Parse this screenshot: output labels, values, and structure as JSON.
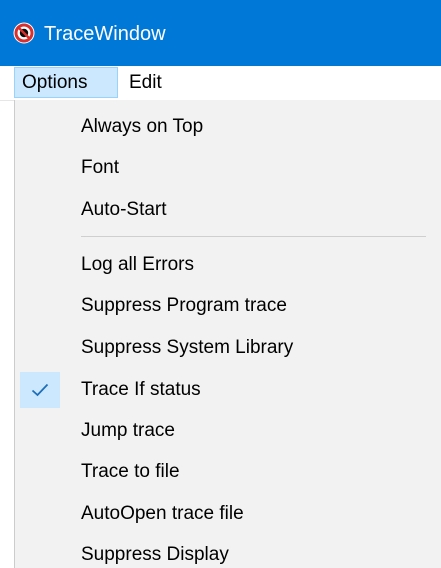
{
  "window": {
    "title": "TraceWindow",
    "icon": "no-entry-icon"
  },
  "menubar": {
    "items": [
      {
        "label": "Options",
        "active": true
      },
      {
        "label": "Edit",
        "active": false
      }
    ]
  },
  "options_menu": {
    "group1": [
      {
        "label": "Always on Top",
        "checked": false
      },
      {
        "label": "Font",
        "checked": false
      },
      {
        "label": "Auto-Start",
        "checked": false
      }
    ],
    "group2": [
      {
        "label": "Log all Errors",
        "checked": false
      },
      {
        "label": "Suppress Program trace",
        "checked": false
      },
      {
        "label": "Suppress System Library",
        "checked": false
      },
      {
        "label": "Trace If status",
        "checked": true
      },
      {
        "label": "Jump trace",
        "checked": false
      },
      {
        "label": "Trace to file",
        "checked": false
      },
      {
        "label": "AutoOpen trace file",
        "checked": false
      },
      {
        "label": "Suppress Display",
        "checked": false
      }
    ]
  },
  "colors": {
    "titlebar": "#0078d7",
    "menu_highlight": "#cce8ff",
    "menu_background": "#f2f2f2",
    "checkmark": "#1e6fb8"
  }
}
